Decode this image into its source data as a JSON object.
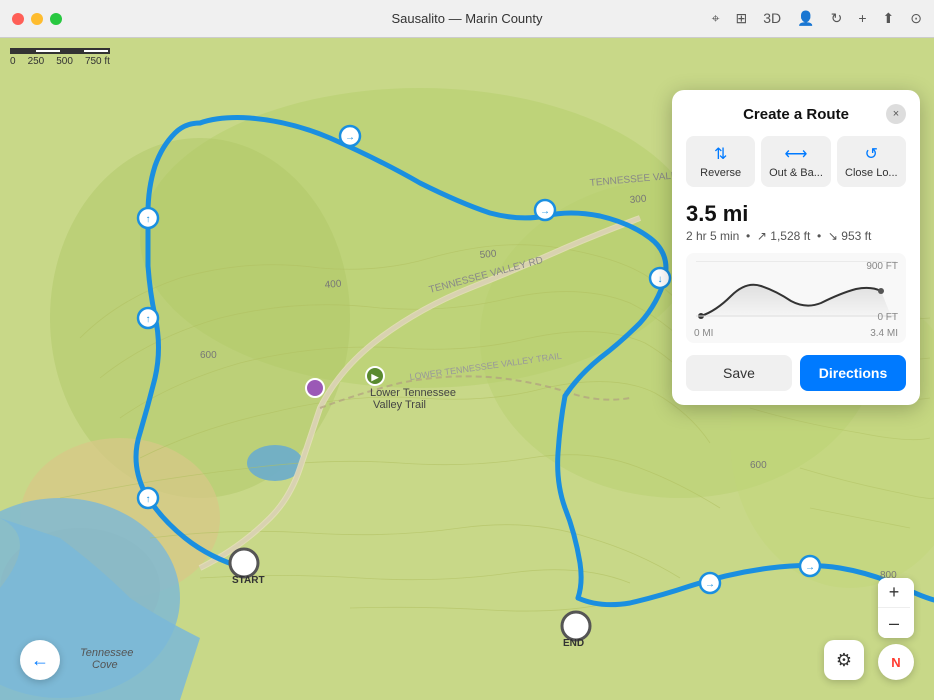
{
  "titlebar": {
    "title": "Sausalito — Marin County",
    "close": "×",
    "min": "–",
    "max": "+"
  },
  "toolbar": {
    "icons": [
      "arrow.up",
      "map",
      "3D",
      "person",
      "arrow.clockwise",
      "+",
      "square.and.arrow.up",
      "person.circle"
    ]
  },
  "scale": {
    "label_0": "0",
    "label_250": "250",
    "label_500": "500",
    "label_750ft": "750 ft"
  },
  "panel": {
    "title": "Create a Route",
    "close_label": "×",
    "btn_reverse": "Reverse",
    "btn_out_back": "Out & Ba...",
    "btn_close_loop": "Close Lo...",
    "distance": "3.5 mi",
    "time": "2 hr 5 min",
    "elevation_up": "↗ 1,528 ft",
    "elevation_down": "↘ 953 ft",
    "chart_y_top": "900 FT",
    "chart_y_bottom": "0 FT",
    "chart_x_start": "0 MI",
    "chart_x_end": "3.4 MI",
    "save_label": "Save",
    "directions_label": "Directions"
  },
  "markers": {
    "start_label": "START",
    "end_label": "END"
  },
  "map_labels": {
    "tennessee_valley_rd": "TENNESSEE VALLEY RD",
    "lower_tennessee_valley_trail": "LOWER TENNESSEE VALLEY TRAIL",
    "tennessee_valley": "TENNESSEE VALLEY",
    "lower_tennessee": "LOWER TENNESSE...",
    "lower_tennessee_valley_trail_place": "Lower Tennessee\nValley Trail",
    "tennessee_cove": "Tennessee\nCove"
  },
  "controls": {
    "zoom_in": "+",
    "zoom_out": "–",
    "compass": "N",
    "back": "←",
    "filter": "⚙"
  }
}
